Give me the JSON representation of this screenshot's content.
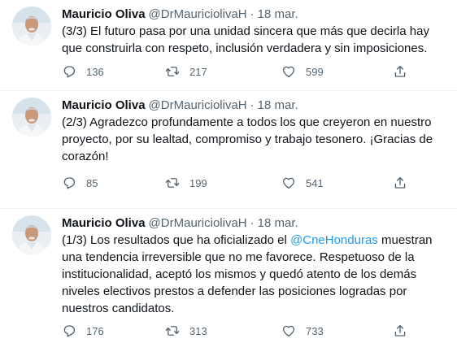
{
  "tweets": [
    {
      "author": {
        "name": "Mauricio Oliva",
        "handle": "@DrMauriciolivaH"
      },
      "date": "18 mar.",
      "text_before": "(3/3) El futuro pasa por una unidad sincera que más que decirla hay que construirla con respeto, inclusión verdadera y sin imposiciones.",
      "mention": "",
      "text_after": "",
      "replies": "136",
      "retweets": "217",
      "likes": "599"
    },
    {
      "author": {
        "name": "Mauricio Oliva",
        "handle": "@DrMauriciolivaH"
      },
      "date": "18 mar.",
      "text_before": "(2/3) Agradezco profundamente a todos los que creyeron en nuestro proyecto, por su lealtad, compromiso y trabajo tesonero. ¡Gracias de corazón!",
      "mention": "",
      "text_after": "",
      "replies": "85",
      "retweets": "199",
      "likes": "541"
    },
    {
      "author": {
        "name": "Mauricio Oliva",
        "handle": "@DrMauriciolivaH"
      },
      "date": "18 mar.",
      "text_before": "(1/3) Los resultados que ha oficializado el ",
      "mention": "@CneHonduras",
      "text_after": " muestran una tendencia irreversible que no me favorece. Respetuoso de la institucionalidad, aceptó los mismos y quedó atento de los demás niveles electivos prestos a defender las posiciones logradas por nuestros candidatos.",
      "replies": "176",
      "retweets": "313",
      "likes": "733"
    }
  ],
  "separator": "·",
  "icons": {
    "reply": "reply-icon",
    "retweet": "retweet-icon",
    "like": "heart-icon",
    "share": "share-icon"
  },
  "colors": {
    "text": "#0f1419",
    "secondary": "#536471",
    "link": "#1d9bf0",
    "divider": "#eff3f4"
  }
}
